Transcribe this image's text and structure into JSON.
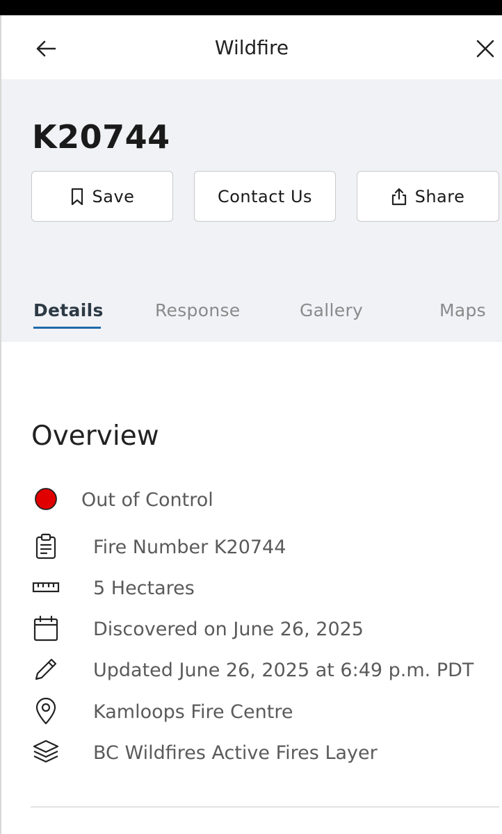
{
  "header": {
    "title": "Wildfire",
    "back_icon": "arrow-left-icon",
    "close_icon": "close-icon"
  },
  "fire": {
    "id": "K20744"
  },
  "actions": {
    "save_label": "Save",
    "contact_label": "Contact Us",
    "share_label": "Share"
  },
  "tabs": [
    {
      "label": "Details",
      "active": true
    },
    {
      "label": "Response",
      "active": false
    },
    {
      "label": "Gallery",
      "active": false
    },
    {
      "label": "Maps",
      "active": false
    }
  ],
  "overview": {
    "title": "Overview",
    "items": [
      {
        "icon": "status-dot-icon",
        "text": "Out of Control",
        "color": "#e00000"
      },
      {
        "icon": "clipboard-icon",
        "text": "Fire Number K20744"
      },
      {
        "icon": "ruler-icon",
        "text": "5 Hectares"
      },
      {
        "icon": "calendar-icon",
        "text": "Discovered on June 26, 2025"
      },
      {
        "icon": "pencil-icon",
        "text": "Updated June 26, 2025 at 6:49 p.m. PDT"
      },
      {
        "icon": "location-pin-icon",
        "text": "Kamloops Fire Centre"
      },
      {
        "icon": "layers-icon",
        "text": "BC Wildfires Active Fires Layer"
      }
    ]
  },
  "colors": {
    "panel_bg": "#f1f2f6",
    "active_tab_underline": "#1f6aa8",
    "status_red": "#e00000"
  }
}
